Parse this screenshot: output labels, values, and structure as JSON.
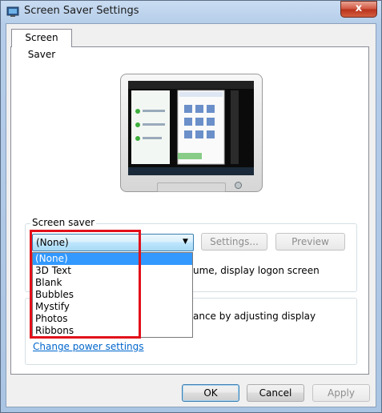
{
  "window": {
    "title": "Screen Saver Settings",
    "close_label": "x"
  },
  "tabs": [
    {
      "label": "Screen Saver"
    }
  ],
  "screensaver": {
    "group_label": "Screen saver",
    "selected": "(None)",
    "settings_label": "Settings...",
    "preview_label": "Preview",
    "resume_text_partial": "ume, display logon screen",
    "options": [
      "(None)",
      "3D Text",
      "Blank",
      "Bubbles",
      "Mystify",
      "Photos",
      "Ribbons"
    ],
    "selected_index": 0
  },
  "power": {
    "text_partial": "ance by adjusting display",
    "link_label": "Change power settings"
  },
  "buttons": {
    "ok": "OK",
    "cancel": "Cancel",
    "apply": "Apply"
  },
  "colors": {
    "highlight_box": "#e2101a",
    "selection": "#3399ff",
    "link": "#0066cc"
  }
}
